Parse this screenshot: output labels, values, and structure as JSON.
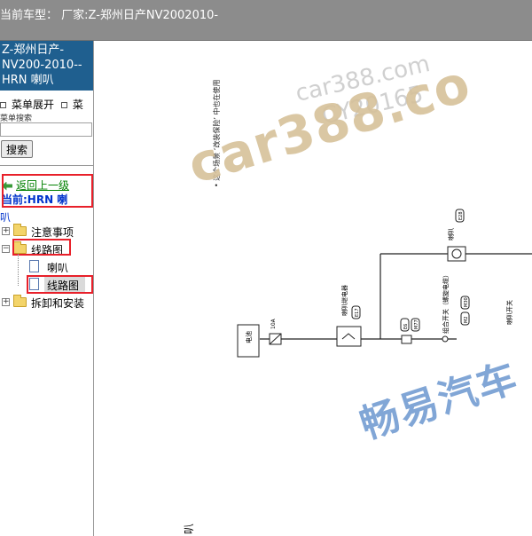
{
  "header": {
    "current_car_text": "当前车型： 厂家:Z-郑州日产NV2002010-"
  },
  "sidebar": {
    "title": "Z-郑州日产-NV200-2010-- HRN 喇叭",
    "menu_expand": "菜单展开",
    "menu_collapse_partial": "菜",
    "search_label": "菜单搜索",
    "search_value": "",
    "search_button": "搜索",
    "back_link": "返回上一级",
    "current": "当前:HRN 喇",
    "partial_word": "叭",
    "tree": [
      {
        "label": "注意事项",
        "expander": "+"
      },
      {
        "label": "线路图",
        "expander": "−"
      },
      {
        "label": "喇叭",
        "child": true
      },
      {
        "label": "线路图",
        "child": true,
        "selected": true
      },
      {
        "label": "拆卸和安装",
        "expander": "+"
      }
    ]
  },
  "diagram": {
    "watermarks": {
      "site": "car388.co",
      "site_small": "car388.com",
      "code": "CY20165",
      "brand": "畅易汽车"
    },
    "notes": "• 这个场景 ‘改装保险’ 中也在使用",
    "labels": {
      "horn": "喇叭",
      "horn_relay": "喇叭继电器",
      "combo_switch": "组合开关（螺旋电缆）",
      "horn_switch": "喇叭开关",
      "battery": "电池",
      "fuse": "10A",
      "code_e17": "E17",
      "code_e27": "E27",
      "code_e28": "E28",
      "code_m8": "M8",
      "code_m77": "M77",
      "code_e6": "E6",
      "code_m30": "M30",
      "code_m2": "M2",
      "bottom_mark": "叭"
    }
  }
}
